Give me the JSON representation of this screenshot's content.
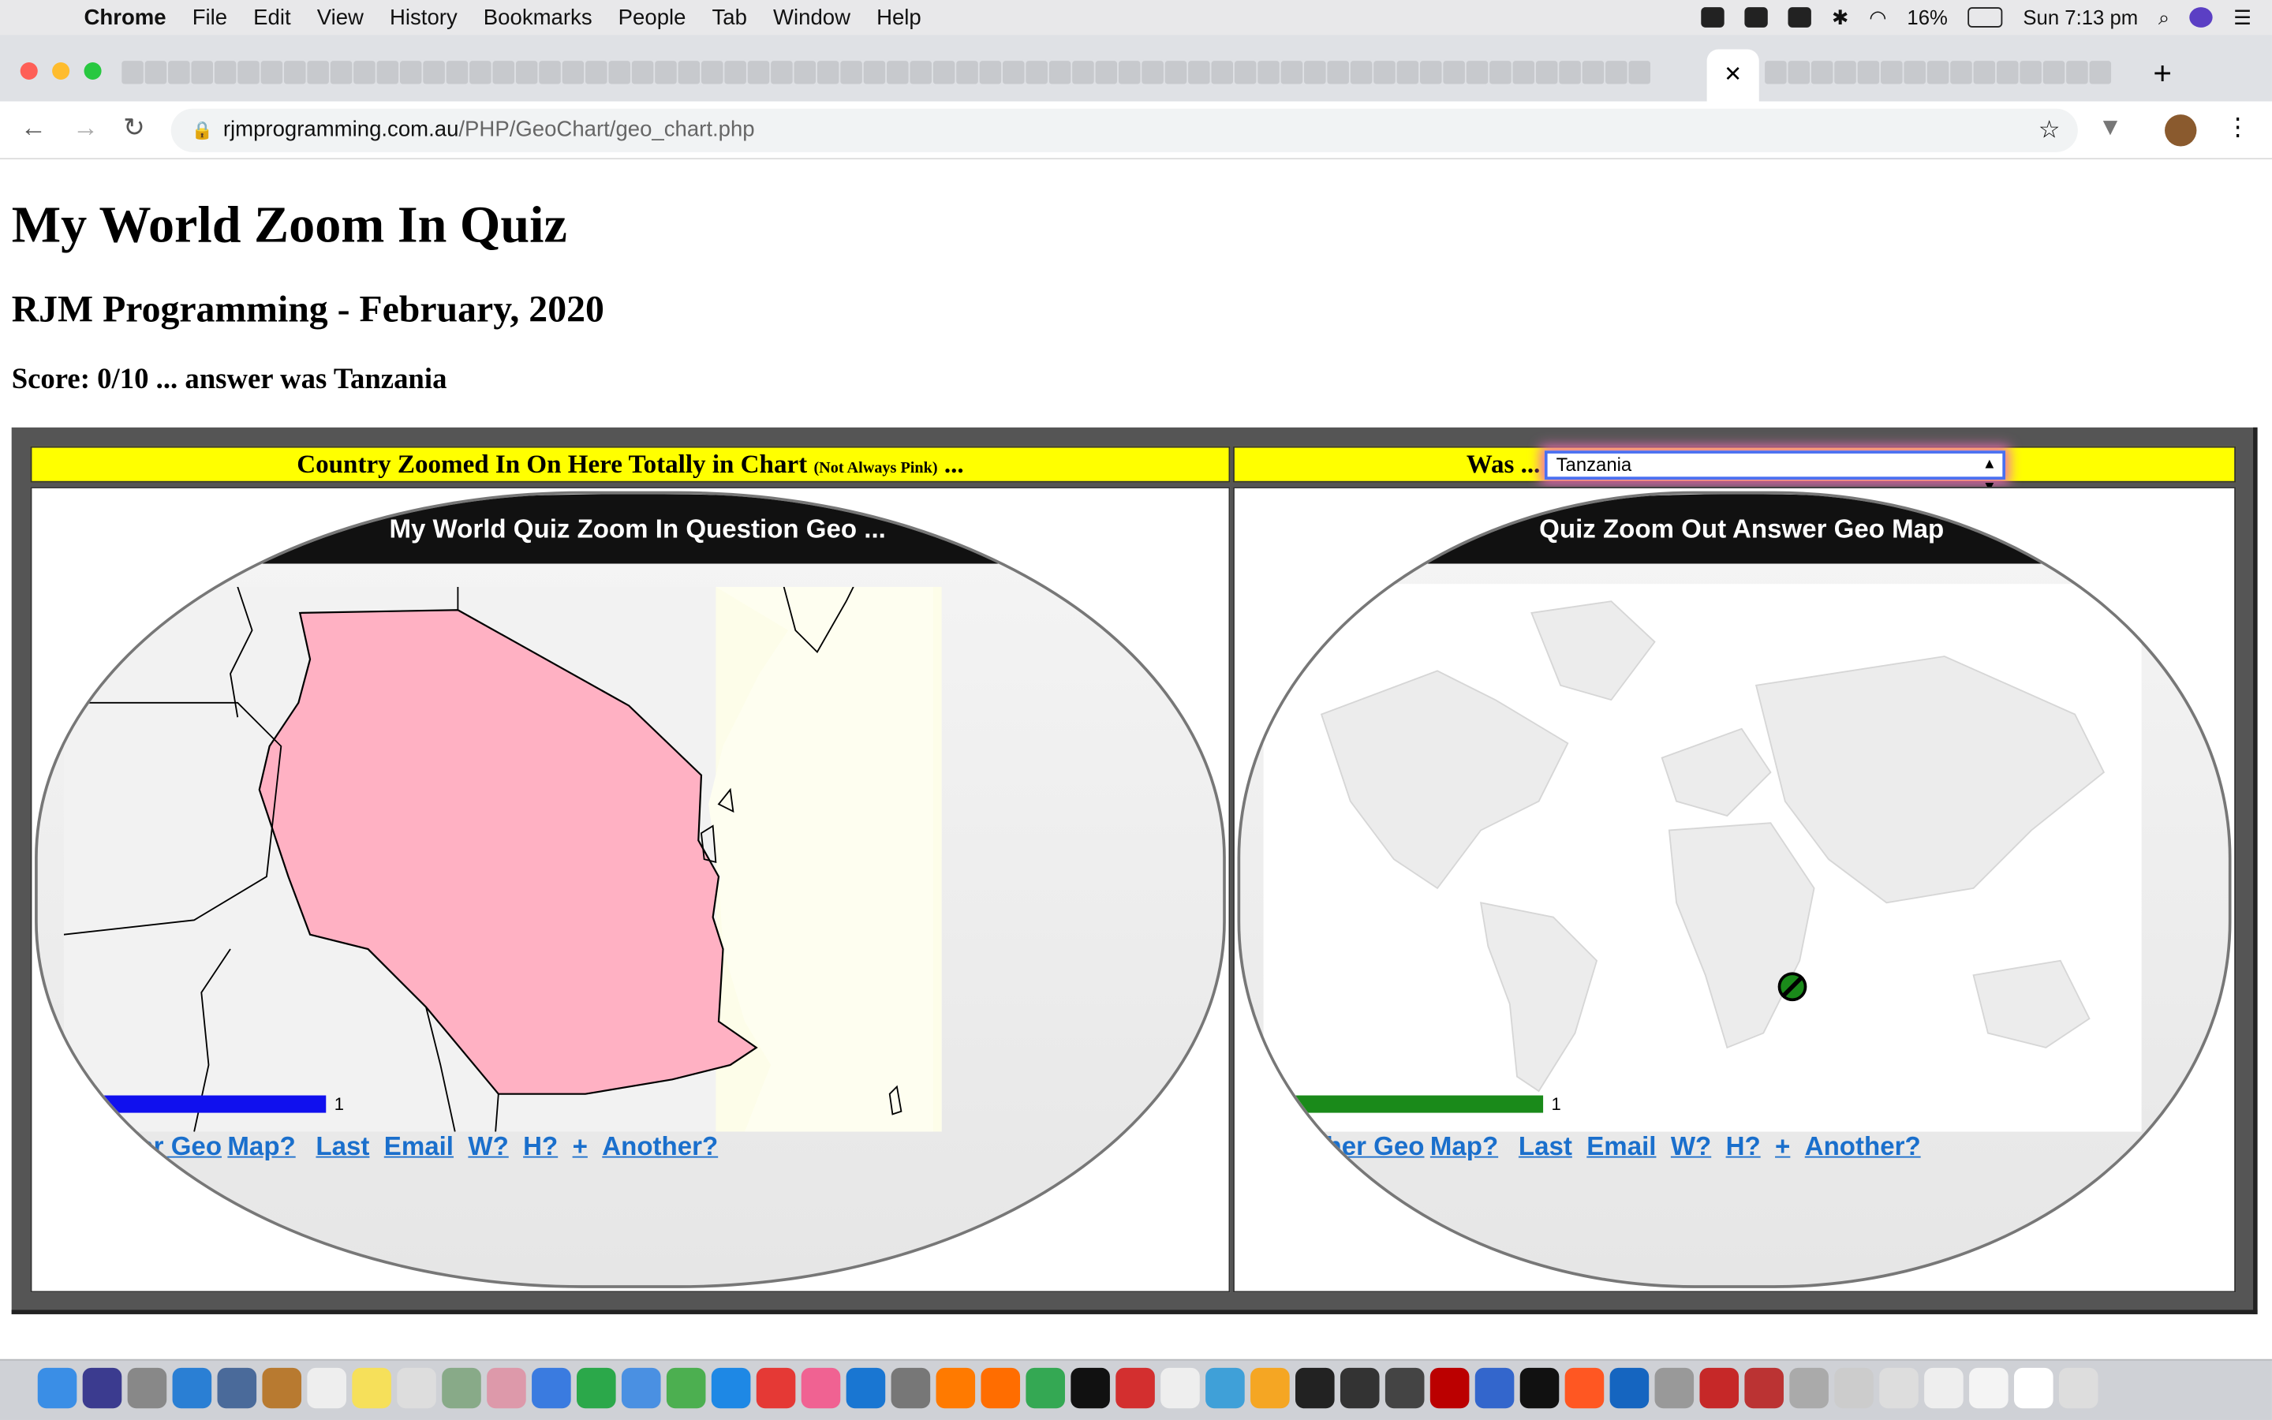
{
  "menubar": {
    "app": "Chrome",
    "items": [
      "File",
      "Edit",
      "View",
      "History",
      "Bookmarks",
      "People",
      "Tab",
      "Window",
      "Help"
    ],
    "battery": "16%",
    "clock": "Sun 7:13 pm"
  },
  "browser": {
    "host": "rjmprogramming.com.au",
    "path": "/PHP/GeoChart/geo_chart.php",
    "tab_close": "✕",
    "new_tab": "+"
  },
  "page": {
    "title": "My World Zoom In Quiz",
    "subtitle": "RJM Programming - February, 2020",
    "score": "Score: 0/10 ... answer was Tanzania"
  },
  "left_panel": {
    "header": "Country Zoomed In On Here Totally in Chart",
    "header_note": "(Not Always Pink)",
    "header_suffix": "...",
    "map_title": "My World Quiz Zoom In Question Geo ...",
    "highlight_color": "#ffb1c3",
    "legend_min": "1",
    "legend_max": "1",
    "legend_color": "#1010ee",
    "links": [
      "Another Geo",
      "Map?",
      "Last",
      "Email",
      "W?",
      "H?",
      "+",
      "Another?"
    ]
  },
  "right_panel": {
    "header_prefix": "Was ...",
    "select_value": "Tanzania",
    "map_title": "Quiz Zoom Out Answer Geo Map",
    "legend_min": "1",
    "legend_max": "1",
    "legend_color": "#1a8a1a",
    "links": [
      "Another Geo",
      "Map?",
      "Last",
      "Email",
      "W?",
      "H?",
      "+",
      "Another?"
    ]
  }
}
